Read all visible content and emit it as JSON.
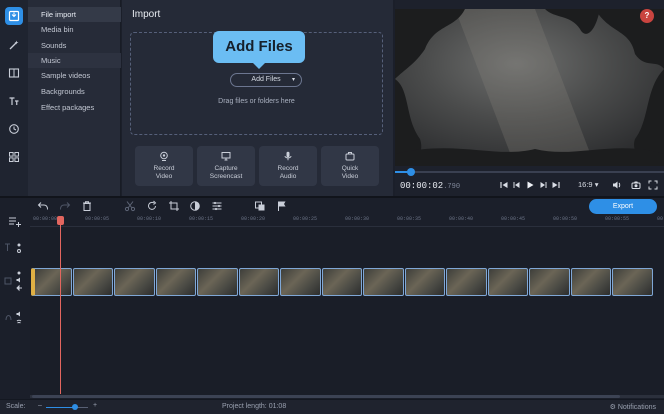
{
  "sidebar": {
    "items": [
      {
        "label": "File import",
        "selected": true
      },
      {
        "label": "Media bin"
      },
      {
        "label": "Sounds"
      },
      {
        "label": "Music"
      },
      {
        "label": "Sample videos"
      },
      {
        "label": "Backgrounds"
      },
      {
        "label": "Effect packages"
      }
    ]
  },
  "import_panel": {
    "title": "Import",
    "add_files_label": "Add Files",
    "drag_hint": "Drag files or folders here",
    "callout": "Add Files",
    "quick_actions": [
      {
        "line1": "Record",
        "line2": "Video",
        "icon": "webcam-icon"
      },
      {
        "line1": "Capture",
        "line2": "Screencast",
        "icon": "monitor-icon"
      },
      {
        "line1": "Record",
        "line2": "Audio",
        "icon": "microphone-icon"
      },
      {
        "line1": "Quick",
        "line2": "Video",
        "icon": "briefcase-icon"
      }
    ]
  },
  "preview": {
    "help": "?",
    "timecode": "00:00:02",
    "timecode_frac": ".790",
    "aspect_ratio": "16:9",
    "progress": 0.05
  },
  "toolbar": {
    "export_label": "Export"
  },
  "ruler": {
    "ticks": [
      "00:00:00",
      "00:00:05",
      "00:00:10",
      "00:00:15",
      "00:00:20",
      "00:00:25",
      "00:00:30",
      "00:00:35",
      "00:00:40",
      "00:00:45",
      "00:00:50",
      "00:00:55",
      "00:01:00"
    ]
  },
  "timeline": {
    "clip_count": 15
  },
  "status": {
    "scale_label": "Scale:",
    "project_length": "Project length:  01:08",
    "notifications": "Notifications",
    "scale_level": 0.7
  },
  "colors": {
    "accent": "#2e8fe6",
    "playhead": "#e2665f",
    "callout": "#6bbdf3",
    "help_badge": "#c9443f"
  }
}
